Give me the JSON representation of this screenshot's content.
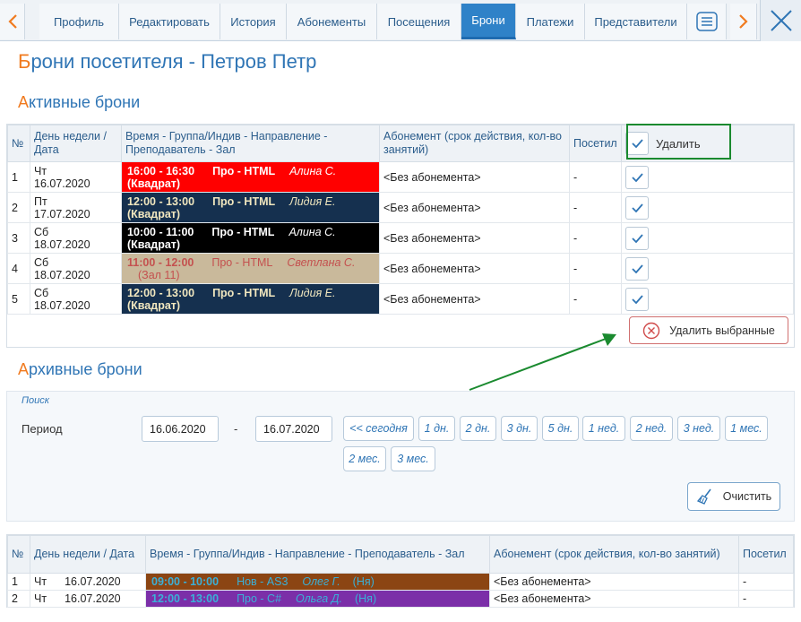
{
  "tabs": [
    {
      "label": "Профиль",
      "active": false
    },
    {
      "label": "Редактировать",
      "active": false
    },
    {
      "label": "История",
      "active": false
    },
    {
      "label": "Абонементы",
      "active": false
    },
    {
      "label": "Посещения",
      "active": false
    },
    {
      "label": "Брони",
      "active": true
    },
    {
      "label": "Платежи",
      "active": false
    },
    {
      "label": "Представители",
      "active": false
    }
  ],
  "icons": {
    "prev": "chevron-left-icon",
    "next": "chevron-right-icon",
    "menu": "menu-icon",
    "close": "close-icon",
    "check": "check-icon",
    "delete": "circle-x-icon",
    "clear": "broom-icon"
  },
  "colors": {
    "accent": "#2f75b5",
    "orange": "#f07b20",
    "green": "#1a8a2f",
    "lesson_red": "#ff0000",
    "lesson_navy": "#15304f",
    "lesson_black": "#000000",
    "lesson_beige": "#c9b99b",
    "lesson_brown": "#8b4513",
    "lesson_purple": "#7b2fa8"
  },
  "page_title": {
    "first": "Б",
    "rest": "рони посетителя - Петров Петр"
  },
  "active_section": {
    "first": "А",
    "rest": "ктивные брони"
  },
  "archive_section": {
    "first": "А",
    "rest": "рхивные брони"
  },
  "active_table": {
    "headers": {
      "num": "№",
      "day": "День недели / Дата",
      "time": "Время - Группа/Индив - Направление - Преподаватель - Зал",
      "sub": "Абонемент (срок действия, кол-во занятий)",
      "visited": "Посетил",
      "delete": "Удалить"
    },
    "rows": [
      {
        "num": "1",
        "day": "Чт",
        "date": "16.07.2020",
        "time": "16:00 - 16:30",
        "group": "Про - HTML",
        "teacher": "Алина С.",
        "hall": "(Квадрат)",
        "sub": "<Без абонемента>",
        "visited": "-"
      },
      {
        "num": "2",
        "day": "Пт",
        "date": "17.07.2020",
        "time": "12:00 - 13:00",
        "group": "Про - HTML",
        "teacher": "Лидия Е.",
        "hall": "(Квадрат)",
        "sub": "<Без абонемента>",
        "visited": "-"
      },
      {
        "num": "3",
        "day": "Сб",
        "date": "18.07.2020",
        "time": "10:00 - 11:00",
        "group": "Про - HTML",
        "teacher": "Алина С.",
        "hall": "(Квадрат)",
        "sub": "<Без абонемента>",
        "visited": "-"
      },
      {
        "num": "4",
        "day": "Сб",
        "date": "18.07.2020",
        "time": "11:00 - 12:00",
        "group": "Про - HTML",
        "teacher": "Светлана С.",
        "hall": "(Зал 11)",
        "sub": "<Без абонемента>",
        "visited": "-"
      },
      {
        "num": "5",
        "day": "Сб",
        "date": "18.07.2020",
        "time": "12:00 - 13:00",
        "group": "Про - HTML",
        "teacher": "Лидия Е.",
        "hall": "(Квадрат)",
        "sub": "<Без абонемента>",
        "visited": "-"
      }
    ],
    "delete_selected_label": "Удалить выбранные"
  },
  "search": {
    "title": "Поиск",
    "period_label": "Период",
    "date_from": "16.06.2020",
    "dash": "-",
    "date_to": "16.07.2020",
    "buttons": [
      "<< сегодня",
      "1 дн.",
      "2 дн.",
      "3 дн.",
      "5 дн.",
      "1 нед.",
      "2 нед.",
      "3 нед.",
      "1 мес.",
      "2 мес.",
      "3 мес."
    ],
    "clear_label": "Очистить"
  },
  "archive_table": {
    "headers": {
      "num": "№",
      "day": "День недели / Дата",
      "time": "Время - Группа/Индив - Направление - Преподаватель - Зал",
      "sub": "Абонемент (срок действия, кол-во занятий)",
      "visited": "Посетил"
    },
    "rows": [
      {
        "num": "1",
        "day": "Чт",
        "date": "16.07.2020",
        "time": "09:00 - 10:00",
        "group": "Нов - AS3",
        "teacher": "Олег Г.",
        "hall": "(Ня)",
        "sub": "<Без абонемента>",
        "visited": "-"
      },
      {
        "num": "2",
        "day": "Чт",
        "date": "16.07.2020",
        "time": "12:00 - 13:00",
        "group": "Про - C#",
        "teacher": "Ольга Д.",
        "hall": "(Ня)",
        "sub": "<Без абонемента>",
        "visited": "-"
      }
    ]
  }
}
